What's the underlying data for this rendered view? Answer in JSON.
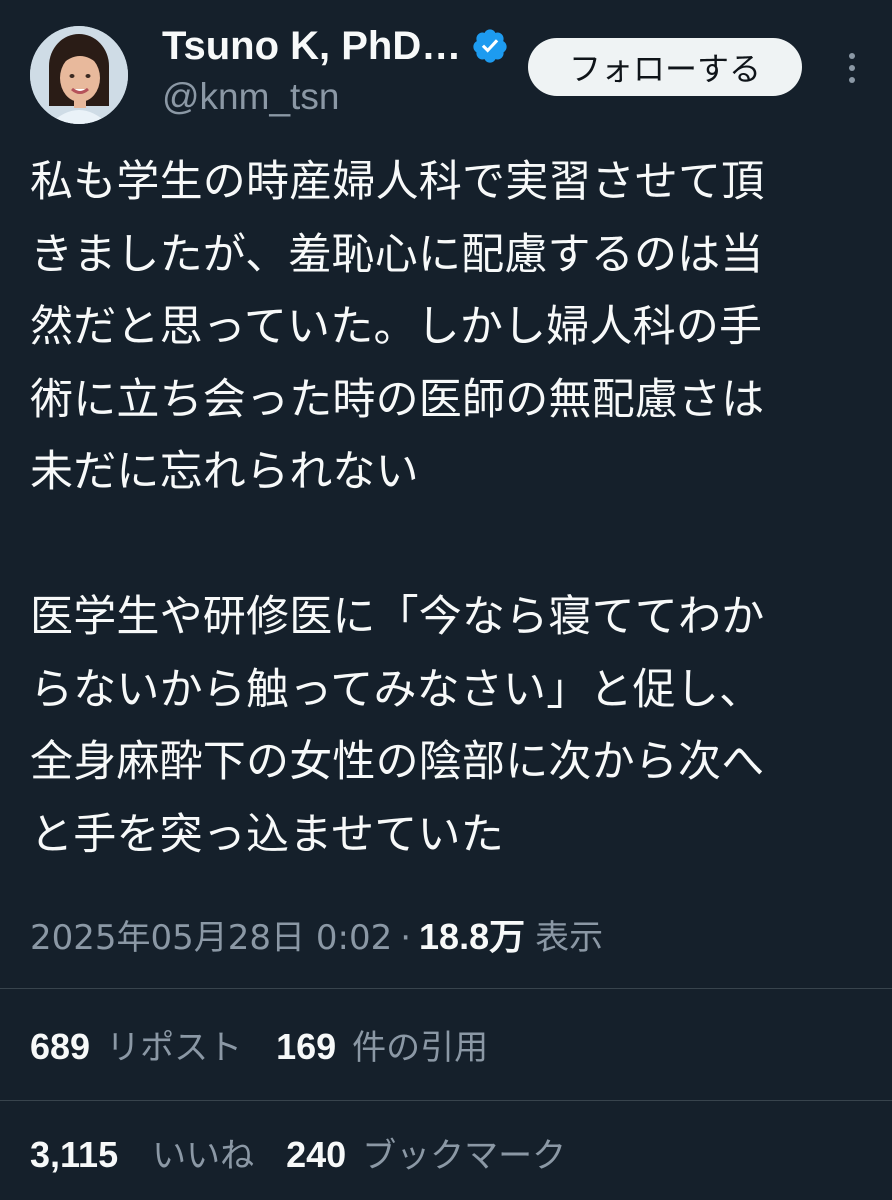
{
  "author": {
    "display_name": "Tsuno K, PhD…",
    "handle": "@knm_tsn",
    "verified": true
  },
  "actions": {
    "follow_label": "フォローする",
    "more_icon": "more-dots-vertical-icon"
  },
  "tweet": {
    "lines": [
      "私も学生の時産婦人科で実習させて頂",
      "きましたが、羞恥心に配慮するのは当",
      "然だと思っていた。しかし婦人科の手",
      "術に立ち会った時の医師の無配慮さは",
      "未だに忘れられない",
      "",
      "医学生や研修医に「今なら寝ててわか",
      "らないから触ってみなさい」と促し、",
      "全身麻酔下の女性の陰部に次から次へ",
      "と手を突っ込ませていた"
    ]
  },
  "meta": {
    "timestamp": "2025年05月28日 0:02",
    "separator": "·",
    "views_count": "18.8万",
    "views_label": "表示"
  },
  "stats": {
    "reposts_count": "689",
    "reposts_label": "リポスト",
    "quotes_count": "169",
    "quotes_label": "件の引用",
    "likes_count": "3,115",
    "likes_label": "いいね",
    "bookmarks_count": "240",
    "bookmarks_label": "ブックマーク"
  },
  "colors": {
    "background": "#15202b",
    "text": "#f7f9f9",
    "secondary_text": "#8b98a5",
    "verified_blue": "#1d9bf0",
    "divider": "#38444d",
    "follow_button_bg": "#eff3f4"
  }
}
